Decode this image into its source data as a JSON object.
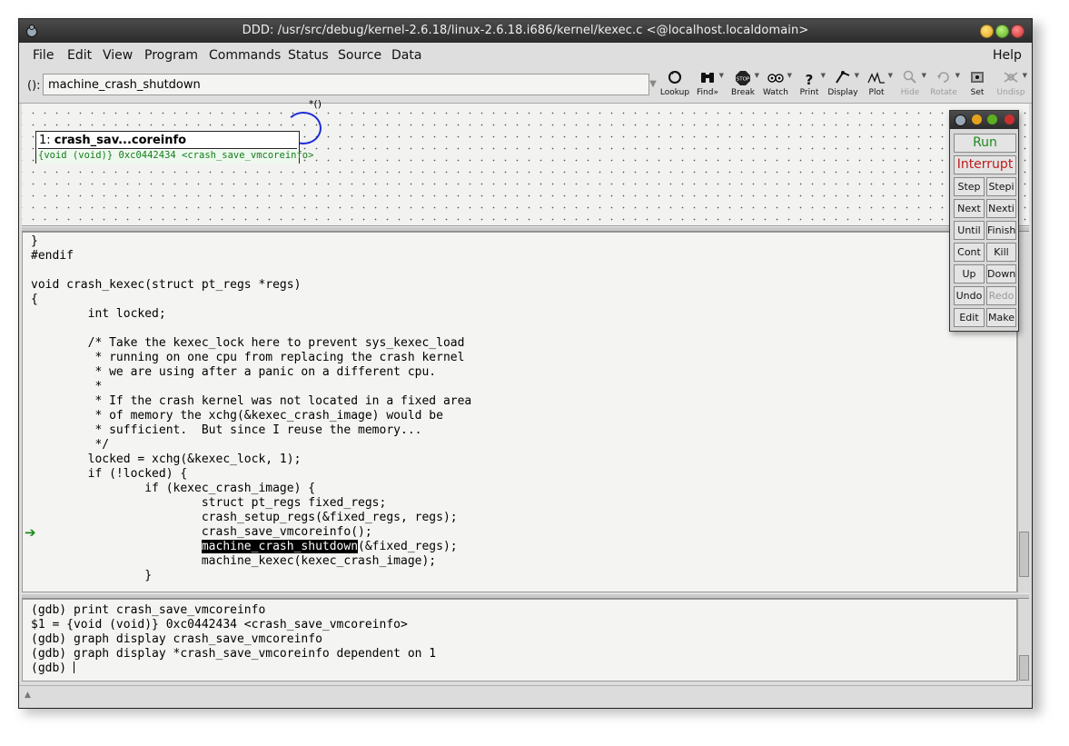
{
  "window": {
    "title": "DDD: /usr/src/debug/kernel-2.6.18/linux-2.6.18.i686/kernel/kexec.c <@localhost.localdomain>"
  },
  "menu": {
    "file": "File",
    "edit": "Edit",
    "view": "View",
    "program": "Program",
    "commands": "Commands",
    "status": "Status",
    "source": "Source",
    "data": "Data",
    "help": "Help"
  },
  "toolbar": {
    "arg_label": "():",
    "arg_value": "machine_crash_shutdown",
    "buttons": {
      "lookup": "Lookup",
      "find": "Find»",
      "break": "Break",
      "watch": "Watch",
      "print": "Print",
      "display": "Display",
      "plot": "Plot",
      "hide": "Hide",
      "rotate": "Rotate",
      "set": "Set",
      "undisp": "Undisp"
    },
    "break_icon_text": "STOP"
  },
  "data_display": {
    "node_number": "1:",
    "node_name": "crash_sav...coreinfo",
    "node_value": "{void (void)} 0xc0442434 <crash_save_vmcoreinfo>",
    "edge_label": "*()"
  },
  "source": {
    "lines_before": "}\n#endif\n\nvoid crash_kexec(struct pt_regs *regs)\n{\n        int locked;\n\n        /* Take the kexec_lock here to prevent sys_kexec_load\n         * running on one cpu from replacing the crash kernel\n         * we are using after a panic on a different cpu.\n         *\n         * If the crash kernel was not located in a fixed area\n         * of memory the xchg(&kexec_crash_image) would be\n         * sufficient.  But since I reuse the memory...\n         */\n        locked = xchg(&kexec_lock, 1);\n        if (!locked) {\n                if (kexec_crash_image) {\n                        struct pt_regs fixed_regs;\n                        crash_setup_regs(&fixed_regs, regs);\n                        crash_save_vmcoreinfo();\n                        ",
    "highlight": "machine_crash_shutdown",
    "lines_after": "(&fixed_regs);\n                        machine_kexec(kexec_crash_image);\n                }"
  },
  "console": {
    "text": "(gdb) print crash_save_vmcoreinfo\n$1 = {void (void)} 0xc0442434 <crash_save_vmcoreinfo>\n(gdb) graph display crash_save_vmcoreinfo\n(gdb) graph display *crash_save_vmcoreinfo dependent on 1\n(gdb) "
  },
  "command_tool": {
    "run": "Run",
    "interrupt": "Interrupt",
    "step": "Step",
    "stepi": "Stepi",
    "next": "Next",
    "nexti": "Nexti",
    "until": "Until",
    "finish": "Finish",
    "cont": "Cont",
    "kill": "Kill",
    "up": "Up",
    "down": "Down",
    "undo": "Undo",
    "redo": "Redo",
    "edit": "Edit",
    "make": "Make"
  },
  "colors": {
    "run": "#1d8a1d",
    "interrupt": "#c01919",
    "value_text": "#137d1b",
    "exec_arrow": "#1a8a1a",
    "edge": "#1d2bd9"
  }
}
